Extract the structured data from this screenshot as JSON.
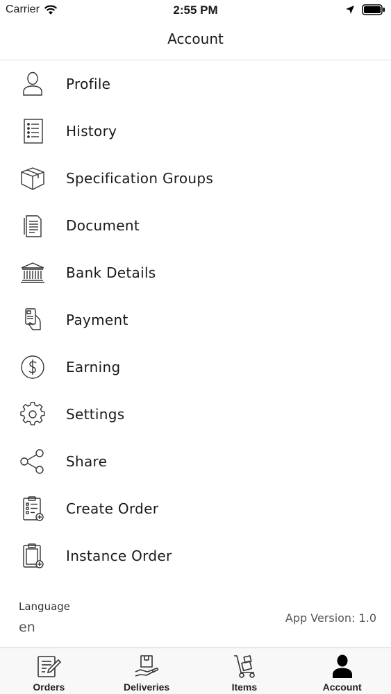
{
  "status_bar": {
    "carrier": "Carrier",
    "time": "2:55 PM",
    "icons": [
      "wifi-icon",
      "location-arrow-icon",
      "battery-icon"
    ]
  },
  "header": {
    "title": "Account"
  },
  "menu": {
    "items": [
      {
        "label": "Profile",
        "icon": "user-icon"
      },
      {
        "label": "History",
        "icon": "list-icon"
      },
      {
        "label": "Specification Groups",
        "icon": "box-icon"
      },
      {
        "label": "Document",
        "icon": "document-icon"
      },
      {
        "label": "Bank Details",
        "icon": "bank-icon"
      },
      {
        "label": "Payment",
        "icon": "card-hand-icon"
      },
      {
        "label": "Earning",
        "icon": "dollar-circle-icon"
      },
      {
        "label": "Settings",
        "icon": "gear-icon"
      },
      {
        "label": "Share",
        "icon": "share-icon"
      },
      {
        "label": "Create Order",
        "icon": "clipboard-add-icon"
      },
      {
        "label": "Instance Order",
        "icon": "clipboard-plus-icon"
      }
    ]
  },
  "footer": {
    "language_label": "Language",
    "language_value": "en",
    "app_version": "App Version: 1.0"
  },
  "tab_bar": {
    "tabs": [
      {
        "label": "Orders",
        "icon": "orders-icon",
        "active": false
      },
      {
        "label": "Deliveries",
        "icon": "delivery-box-icon",
        "active": false
      },
      {
        "label": "Items",
        "icon": "hand-truck-icon",
        "active": false
      },
      {
        "label": "Account",
        "icon": "account-icon",
        "active": true
      }
    ]
  }
}
